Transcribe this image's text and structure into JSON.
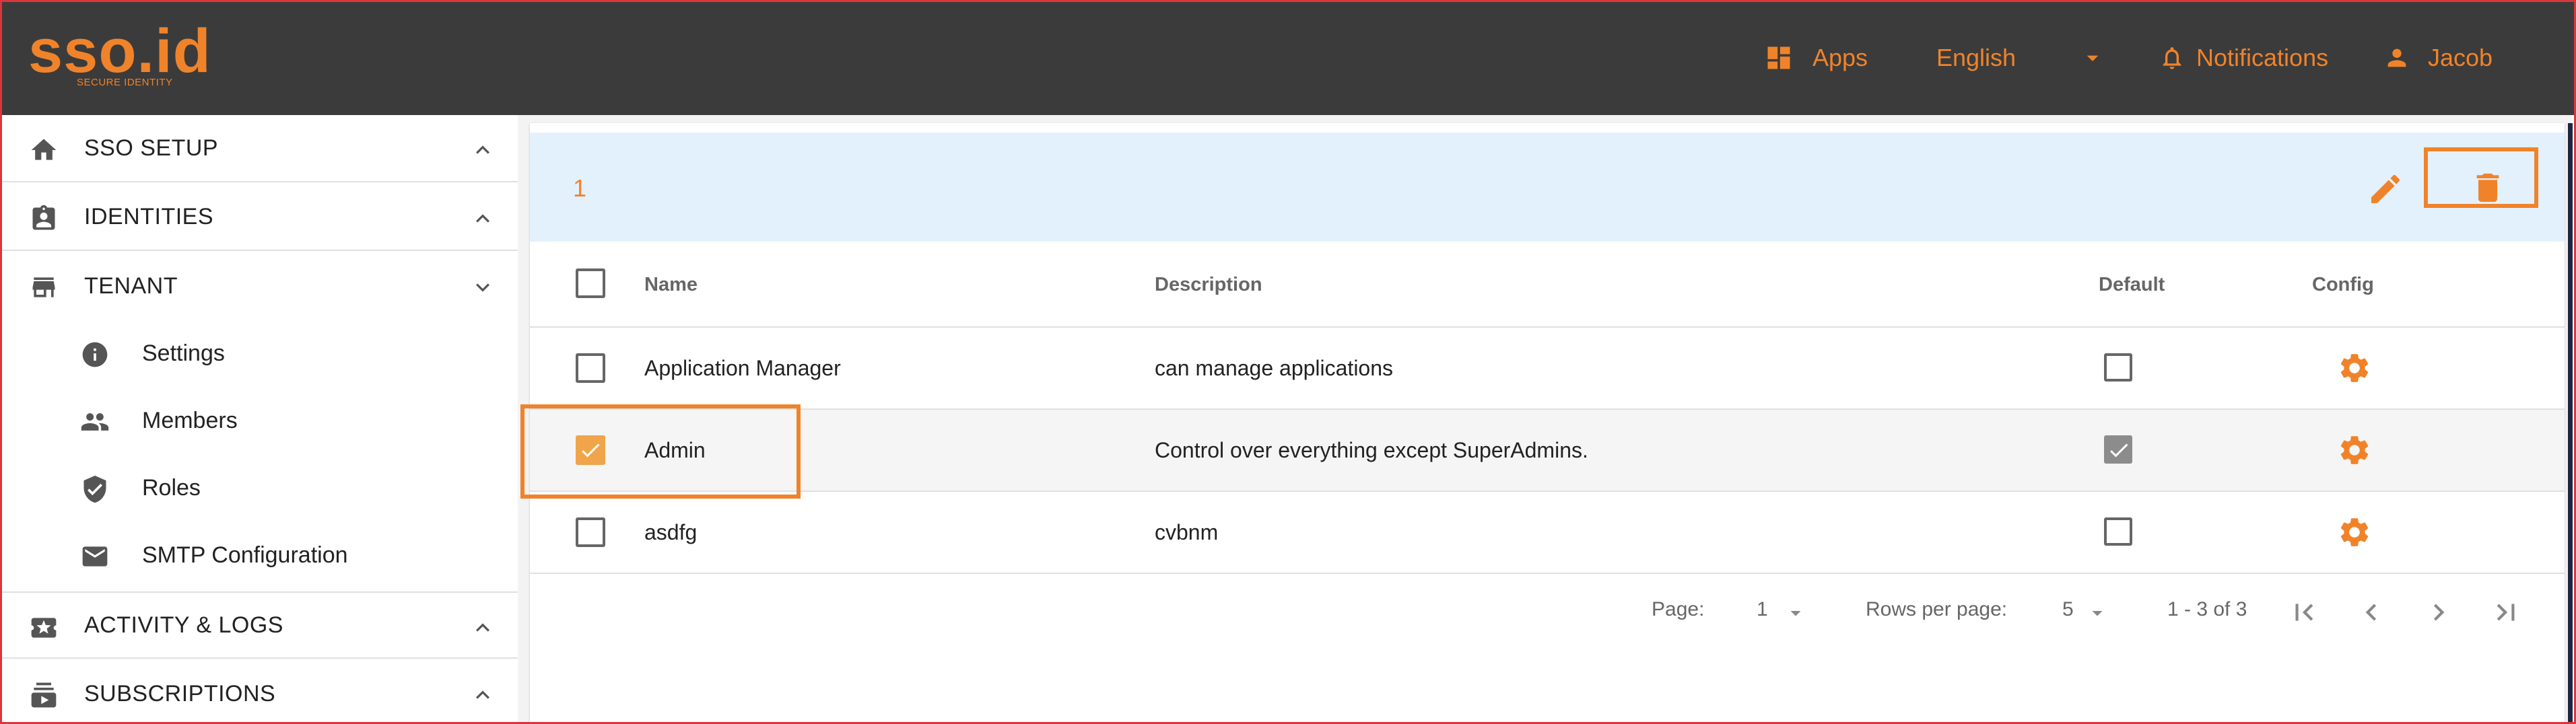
{
  "brand": {
    "logo_text": "sso.id",
    "tagline": "SECURE IDENTITY",
    "accent_color": "#f0832a"
  },
  "topnav": {
    "apps_label": "Apps",
    "language_value": "English",
    "notifications_label": "Notifications",
    "user_label": "Jacob"
  },
  "sidebar": {
    "sections": [
      {
        "label": "SSO SETUP",
        "icon": "home-icon",
        "expanded": false
      },
      {
        "label": "IDENTITIES",
        "icon": "badge-icon",
        "expanded": false
      },
      {
        "label": "TENANT",
        "icon": "store-icon",
        "expanded": true
      },
      {
        "label": "ACTIVITY & LOGS",
        "icon": "star-ticket-icon",
        "expanded": false
      },
      {
        "label": "SUBSCRIPTIONS",
        "icon": "subscriptions-icon",
        "expanded": false
      }
    ],
    "tenant_items": [
      {
        "label": "Settings",
        "icon": "info-icon"
      },
      {
        "label": "Members",
        "icon": "people-icon"
      },
      {
        "label": "Roles",
        "icon": "shield-check-icon"
      },
      {
        "label": "SMTP Configuration",
        "icon": "mail-icon"
      }
    ]
  },
  "toolbar": {
    "selected_count": "1",
    "edit_icon": "pencil-icon",
    "delete_icon": "trash-icon"
  },
  "table": {
    "columns": [
      "Name",
      "Description",
      "Default",
      "Config"
    ],
    "rows": [
      {
        "name": "Application Manager",
        "description": "can manage applications",
        "selected": false,
        "default": false
      },
      {
        "name": "Admin",
        "description": "Control over everything except SuperAdmins.",
        "selected": true,
        "default": true
      },
      {
        "name": "asdfg",
        "description": "cvbnm",
        "selected": false,
        "default": false
      }
    ]
  },
  "pagination": {
    "page_label": "Page:",
    "page_value": "1",
    "rows_label": "Rows per page:",
    "rows_value": "5",
    "range_text": "1 - 3 of 3"
  }
}
